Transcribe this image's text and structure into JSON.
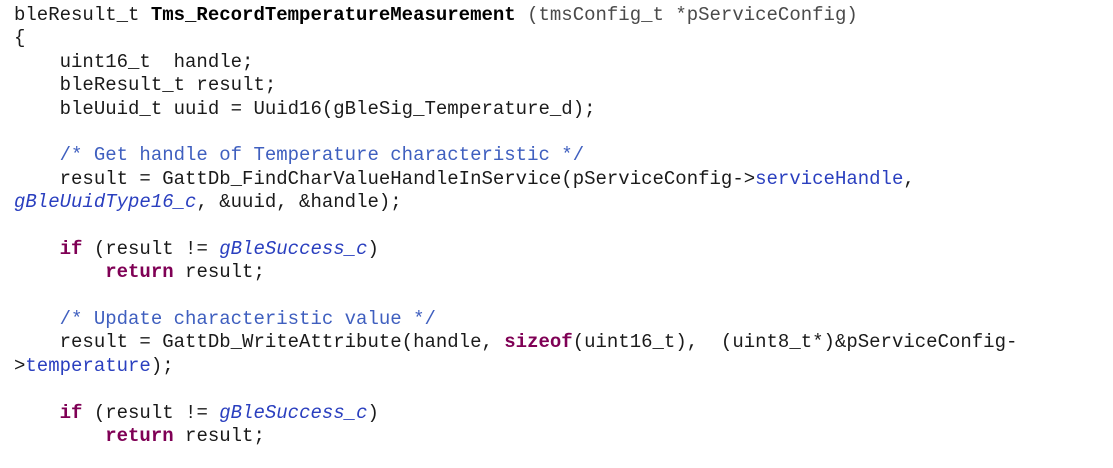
{
  "code": {
    "lines": [
      [
        [
          "pl",
          "bleResult_t "
        ],
        [
          "fnb",
          "Tms_RecordTemperatureMeasurement"
        ],
        [
          "pl-m",
          " (tmsConfig_t *pServiceConfig)"
        ]
      ],
      [
        [
          "pl",
          "{"
        ]
      ],
      [
        [
          "pl",
          "    uint16_t  handle;"
        ]
      ],
      [
        [
          "pl",
          "    bleResult_t result;"
        ]
      ],
      [
        [
          "pl",
          "    bleUuid_t uuid = Uuid16(gBleSig_Temperature_d);"
        ]
      ],
      [
        [
          "pl",
          ""
        ]
      ],
      [
        [
          "pl",
          "    "
        ],
        [
          "cm",
          "/* Get handle of Temperature characteristic */"
        ]
      ],
      [
        [
          "pl",
          "    result = GattDb_FindCharValueHandleInService(pServiceConfig->"
        ],
        [
          "fld",
          "serviceHandle"
        ],
        [
          "pl",
          ","
        ]
      ],
      [
        [
          "cst",
          "gBleUuidType16_c"
        ],
        [
          "pl",
          ", &uuid, &handle);"
        ]
      ],
      [
        [
          "pl",
          ""
        ]
      ],
      [
        [
          "pl",
          "    "
        ],
        [
          "kw",
          "if"
        ],
        [
          "pl",
          " (result != "
        ],
        [
          "cst",
          "gBleSuccess_c"
        ],
        [
          "pl",
          ")"
        ]
      ],
      [
        [
          "pl",
          "        "
        ],
        [
          "kw",
          "return"
        ],
        [
          "pl",
          " result;"
        ]
      ],
      [
        [
          "pl",
          ""
        ]
      ],
      [
        [
          "pl",
          "    "
        ],
        [
          "cm",
          "/* Update characteristic value */"
        ]
      ],
      [
        [
          "pl",
          "    result = GattDb_WriteAttribute(handle, "
        ],
        [
          "kw",
          "sizeof"
        ],
        [
          "pl",
          "(uint16_t),  (uint8_t*)&pServiceConfig-"
        ]
      ],
      [
        [
          "pl",
          ">"
        ],
        [
          "fld",
          "temperature"
        ],
        [
          "pl",
          ");"
        ]
      ],
      [
        [
          "pl",
          ""
        ]
      ],
      [
        [
          "pl",
          "    "
        ],
        [
          "kw",
          "if"
        ],
        [
          "pl",
          " (result != "
        ],
        [
          "cst",
          "gBleSuccess_c"
        ],
        [
          "pl",
          ")"
        ]
      ],
      [
        [
          "pl",
          "        "
        ],
        [
          "kw",
          "return"
        ],
        [
          "pl",
          " result;"
        ]
      ]
    ]
  }
}
